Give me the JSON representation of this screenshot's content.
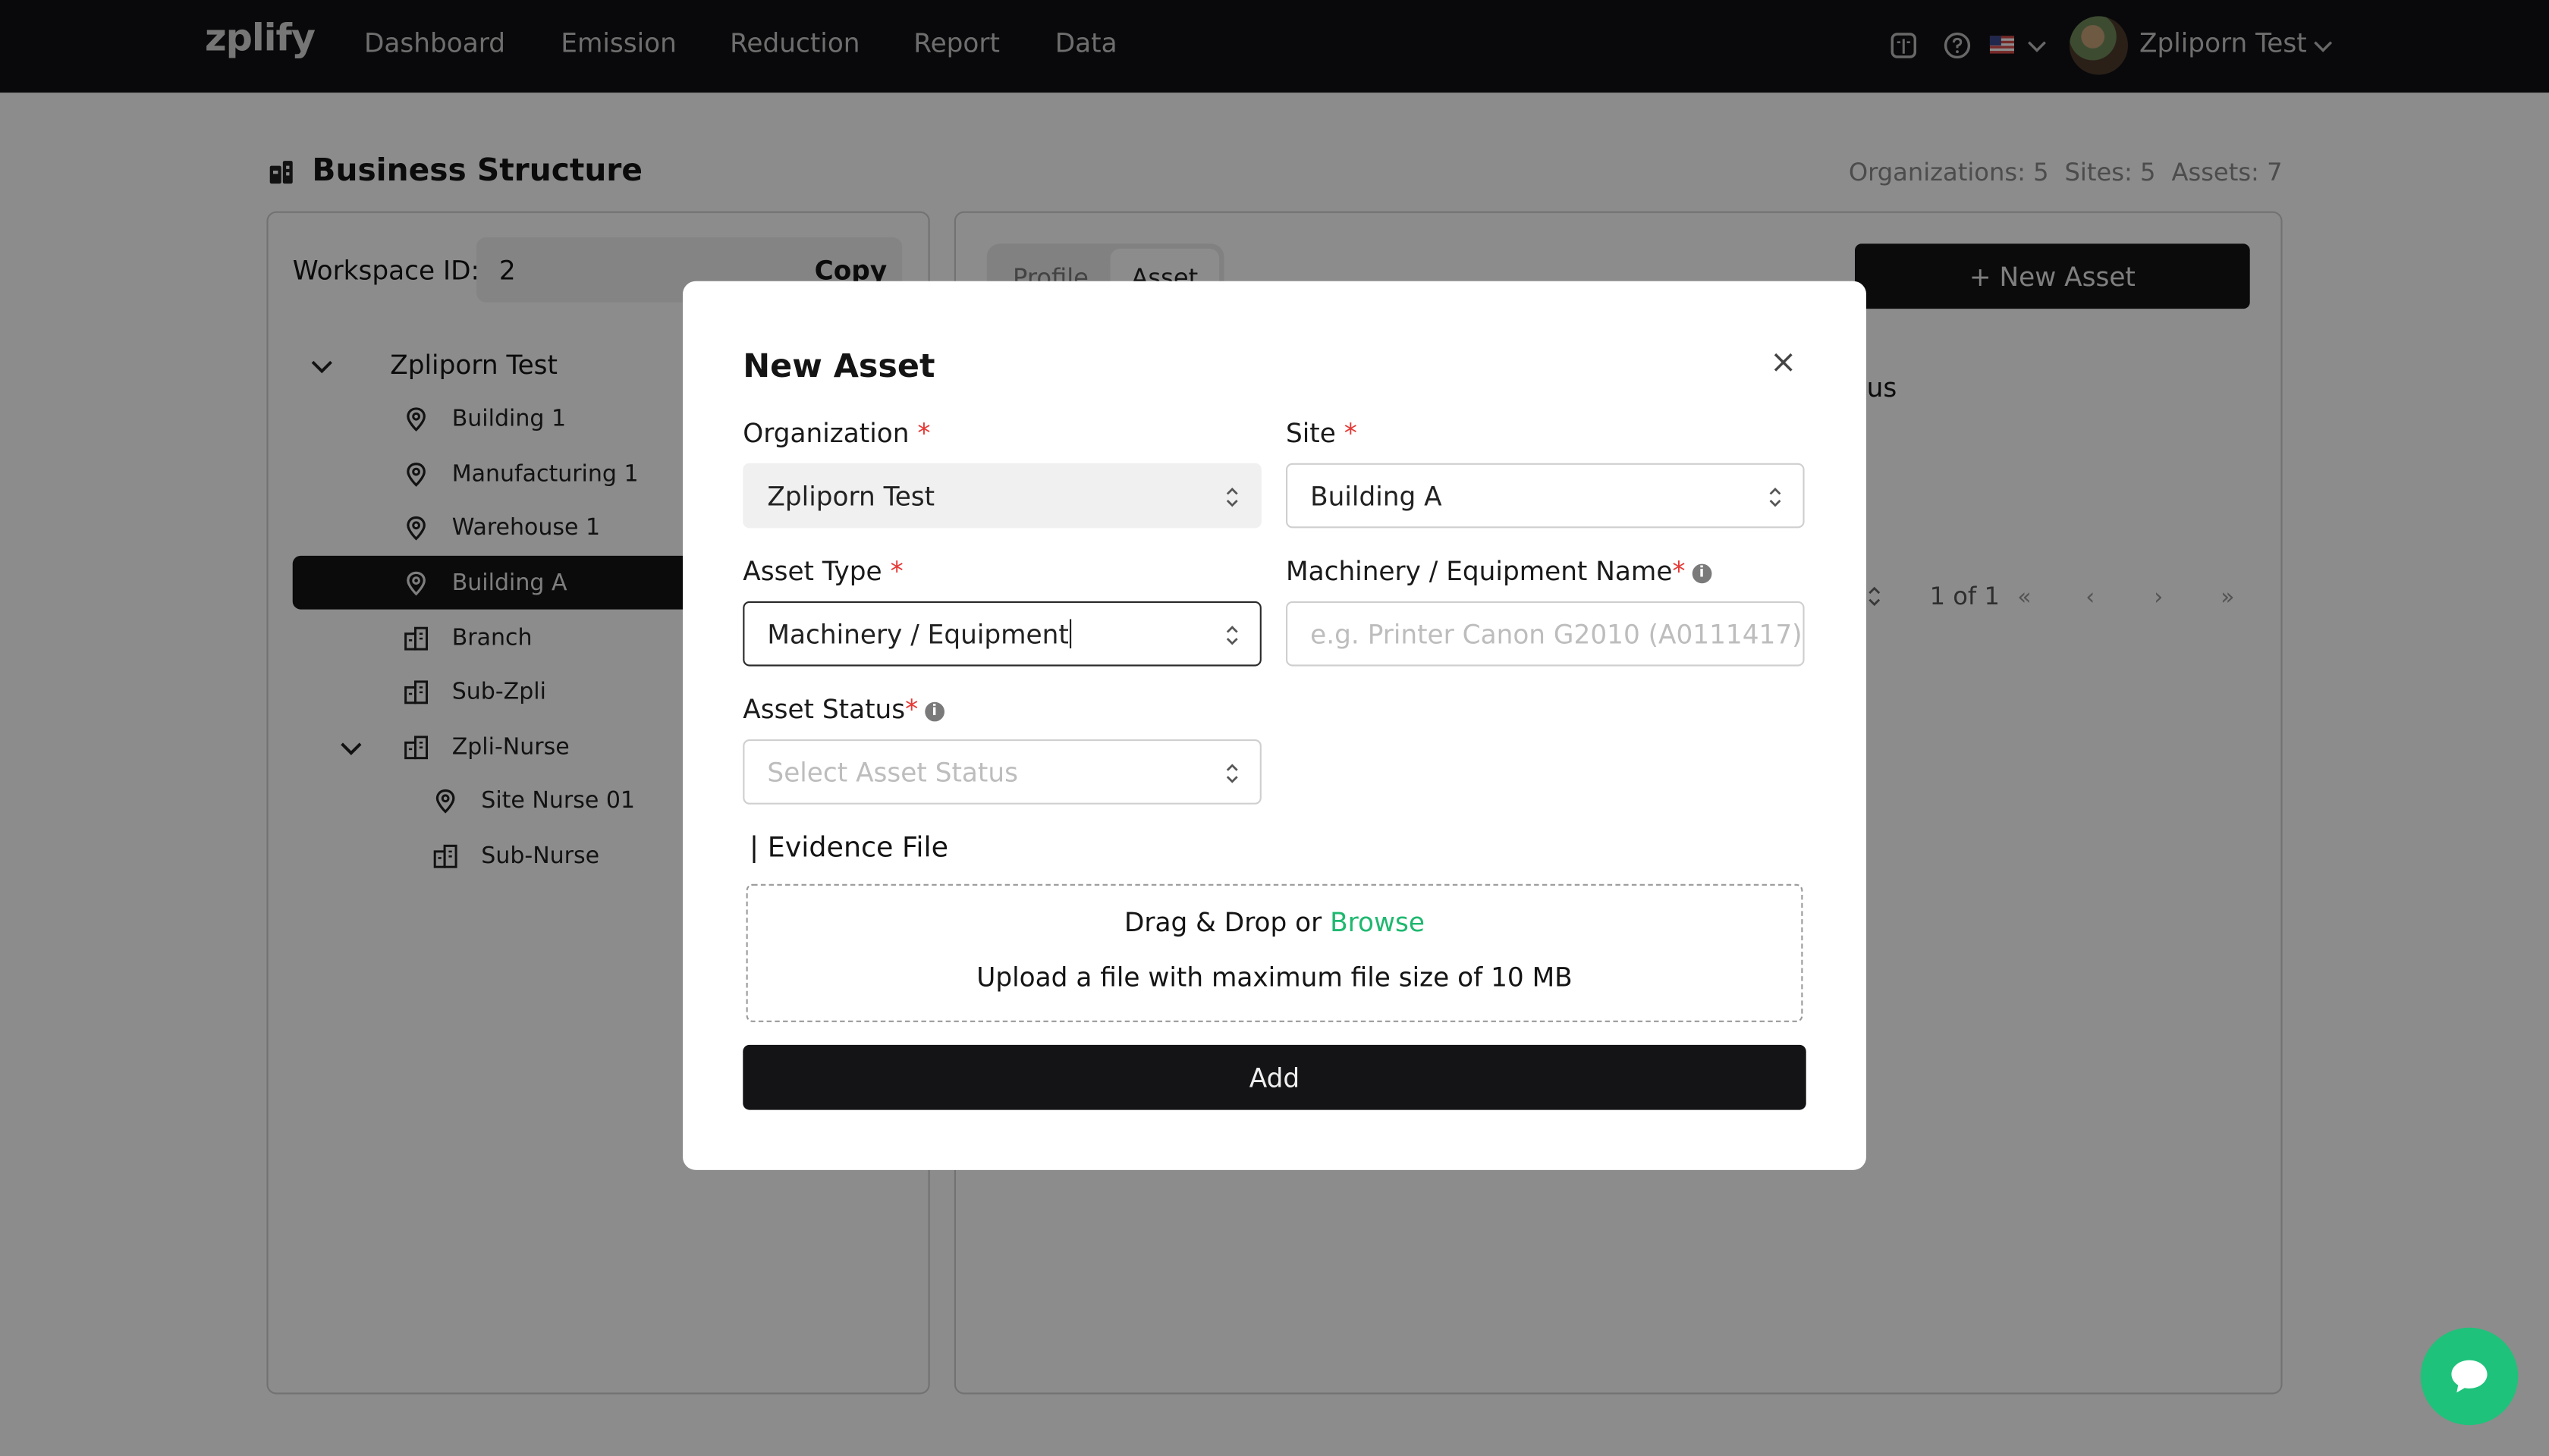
{
  "brand": {
    "logo": "zplify",
    "accent_color": "#1ec27a",
    "dark": "#141416"
  },
  "nav": {
    "items": [
      "Dashboard",
      "Emission",
      "Reduction",
      "Report",
      "Data"
    ]
  },
  "header": {
    "username": "Zpliporn Test",
    "icons": [
      "book-icon",
      "help-icon",
      "us-flag-icon",
      "chevron-down-icon"
    ]
  },
  "page": {
    "title": "Business Structure",
    "stats": {
      "organizations": "Organizations: 5",
      "sites": "Sites: 5",
      "assets": "Assets: 7"
    }
  },
  "workspace": {
    "label": "Workspace ID:",
    "value": "2",
    "copy_label": "Copy"
  },
  "tree": {
    "root": "Zpliporn Test",
    "items": [
      {
        "label": "Building 1",
        "icon": "location-pin-icon"
      },
      {
        "label": "Manufacturing 1",
        "icon": "location-pin-icon"
      },
      {
        "label": "Warehouse 1",
        "icon": "location-pin-icon"
      },
      {
        "label": "Building A",
        "icon": "location-pin-icon",
        "active": true
      },
      {
        "label": "Branch",
        "icon": "building-icon"
      },
      {
        "label": "Sub-Zpli",
        "icon": "building-icon"
      },
      {
        "label": "Zpli-Nurse",
        "icon": "building-icon",
        "expanded": true
      },
      {
        "label": "Site Nurse 01",
        "icon": "location-pin-icon"
      },
      {
        "label": "Sub-Nurse",
        "icon": "building-icon"
      }
    ]
  },
  "right_panel": {
    "tabs": [
      "Profile",
      "Asset"
    ],
    "new_asset_label": "+ New Asset",
    "status_column_fragment": "tus",
    "pagination": "1 of 1"
  },
  "modal": {
    "title": "New Asset",
    "organization": {
      "label": "Organization",
      "required": "*",
      "value": "Zpliporn Test"
    },
    "site": {
      "label": "Site",
      "required": "*",
      "value": "Building A"
    },
    "asset_type": {
      "label": "Asset Type",
      "required": "*",
      "value": "Machinery / Equipment"
    },
    "machinery_name": {
      "label": "Machinery / Equipment Name",
      "required": "*",
      "placeholder": "e.g. Printer Canon G2010 (A0111417)"
    },
    "asset_status": {
      "label": "Asset Status",
      "required": "*",
      "placeholder": "Select Asset Status"
    },
    "evidence": {
      "title": "| Evidence File",
      "drag_text": "Drag & Drop or",
      "browse_text": "Browse",
      "limit_text": "Upload a file with maximum file size of 10 MB"
    },
    "add_label": "Add"
  }
}
